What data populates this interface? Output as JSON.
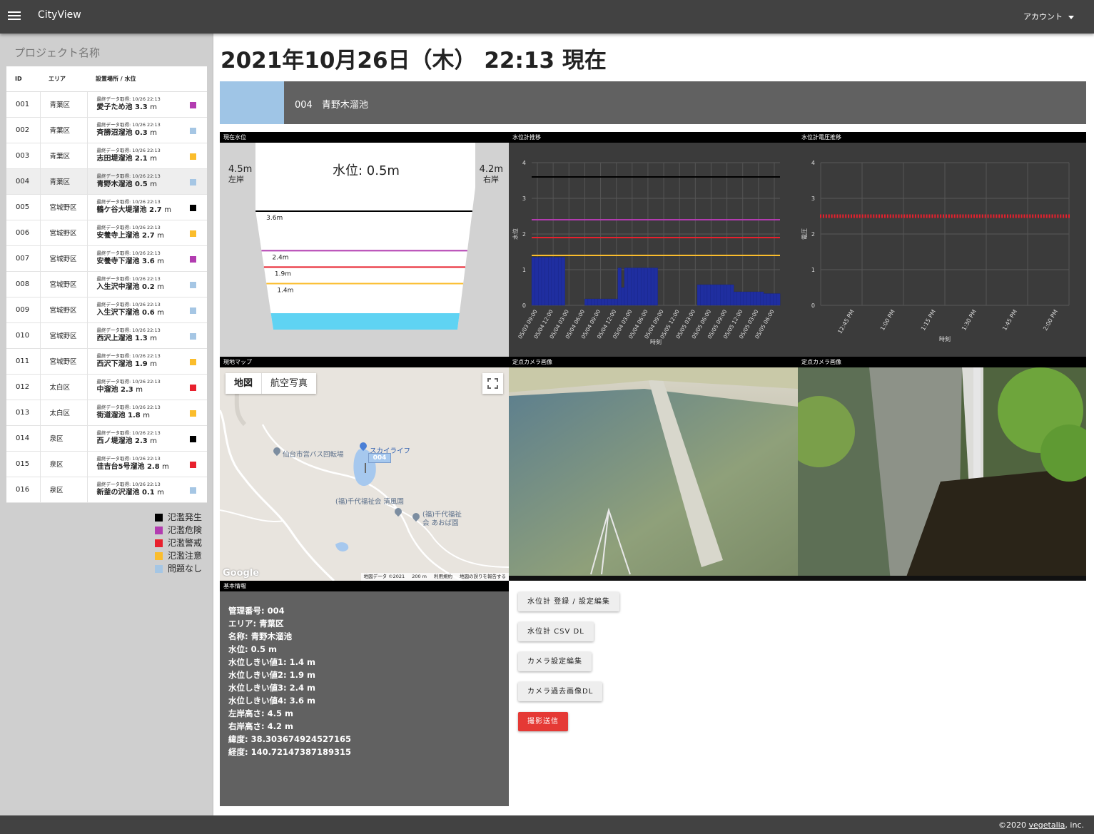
{
  "appbar": {
    "title": "CityView",
    "account_label": "アカウント"
  },
  "sidebar": {
    "project_name": "プロジェクト名称",
    "columns": {
      "id": "ID",
      "area": "エリア",
      "site": "設置場所 / 水位"
    },
    "meta_prefix": "最終データ取得: 10/26 22:13",
    "rows": [
      {
        "id": "001",
        "area": "青葉区",
        "name": "愛子ため池",
        "level": "3.3",
        "unit": "m",
        "status_color": "#b23cb0"
      },
      {
        "id": "002",
        "area": "青葉区",
        "name": "斉勝沼溜池",
        "level": "0.3",
        "unit": "m",
        "status_color": "#a5c6e4"
      },
      {
        "id": "003",
        "area": "青葉区",
        "name": "志田堤溜池",
        "level": "2.1",
        "unit": "m",
        "status_color": "#fbbd2c"
      },
      {
        "id": "004",
        "area": "青葉区",
        "name": "青野木溜池",
        "level": "0.5",
        "unit": "m",
        "status_color": "#a5c6e4"
      },
      {
        "id": "005",
        "area": "宮城野区",
        "name": "鶴ケ谷大堤溜池",
        "level": "2.7",
        "unit": "m",
        "status_color": "#000000"
      },
      {
        "id": "006",
        "area": "宮城野区",
        "name": "安養寺上溜池",
        "level": "2.7",
        "unit": "m",
        "status_color": "#fbbd2c"
      },
      {
        "id": "007",
        "area": "宮城野区",
        "name": "安養寺下溜池",
        "level": "3.6",
        "unit": "m",
        "status_color": "#b23cb0"
      },
      {
        "id": "008",
        "area": "宮城野区",
        "name": "入生沢中溜池",
        "level": "0.2",
        "unit": "m",
        "status_color": "#a5c6e4"
      },
      {
        "id": "009",
        "area": "宮城野区",
        "name": "入生沢下溜池",
        "level": "0.6",
        "unit": "m",
        "status_color": "#a5c6e4"
      },
      {
        "id": "010",
        "area": "宮城野区",
        "name": "西沢上溜池",
        "level": "1.3",
        "unit": "m",
        "status_color": "#a5c6e4"
      },
      {
        "id": "011",
        "area": "宮城野区",
        "name": "西沢下溜池",
        "level": "1.9",
        "unit": "m",
        "status_color": "#fbbd2c"
      },
      {
        "id": "012",
        "area": "太白区",
        "name": "中溜池",
        "level": "2.3",
        "unit": "m",
        "status_color": "#e8202d"
      },
      {
        "id": "013",
        "area": "太白区",
        "name": "街道溜池",
        "level": "1.8",
        "unit": "m",
        "status_color": "#fbbd2c"
      },
      {
        "id": "014",
        "area": "泉区",
        "name": "西ノ堤溜池",
        "level": "2.3",
        "unit": "m",
        "status_color": "#000000"
      },
      {
        "id": "015",
        "area": "泉区",
        "name": "佳吉台5号溜池",
        "level": "2.8",
        "unit": "m",
        "status_color": "#e8202d"
      },
      {
        "id": "016",
        "area": "泉区",
        "name": "新釜の沢溜池",
        "level": "0.1",
        "unit": "m",
        "status_color": "#a5c6e4"
      }
    ],
    "selected_id": "004",
    "legend": [
      {
        "label": "氾濫発生",
        "color": "#000000"
      },
      {
        "label": "氾濫危険",
        "color": "#b23cb0"
      },
      {
        "label": "氾濫警戒",
        "color": "#e8202d"
      },
      {
        "label": "氾濫注意",
        "color": "#fbbd2c"
      },
      {
        "label": "問題なし",
        "color": "#a5c6e4"
      }
    ]
  },
  "main": {
    "title": "2021年10月26日（木） 22:13 現在",
    "banner": {
      "text": "004　青野木溜池",
      "accent_color": "#9fc5e6"
    },
    "panels": {
      "level": "現在水位",
      "chart1": "水位計推移",
      "chart2": "水位計電圧推移",
      "map": "現地マップ",
      "cam1": "定点カメラ画像",
      "cam2": "定点カメラ画像",
      "info": "基本情報"
    },
    "level_diagram": {
      "title": "水位: 0.5m",
      "left_height": "4.5m",
      "left_label": "左岸",
      "right_height": "4.2m",
      "right_label": "右岸",
      "water_level": 0.5,
      "thresholds": [
        {
          "label": "3.6m",
          "value": 3.6,
          "color": "#000000"
        },
        {
          "label": "2.4m",
          "value": 2.4,
          "color": "#b23cb0"
        },
        {
          "label": "1.9m",
          "value": 1.9,
          "color": "#e8202d"
        },
        {
          "label": "1.4m",
          "value": 1.4,
          "color": "#fbbd2c"
        }
      ],
      "water_color": "#5fd3f3"
    },
    "map": {
      "tab_map": "地図",
      "tab_aerial": "航空写真",
      "labels": [
        "仙台市営バス回転場",
        "スカイライフ",
        "(福)千代福祉会 清風園",
        "(福)千代福祉",
        "会 あおば園"
      ],
      "marker": "004",
      "attribution": [
        "地図データ ©2021",
        "200 m",
        "利用規約",
        "地図の誤りを報告する"
      ],
      "logo": "Google"
    },
    "info": [
      "管理番号: 004",
      "エリア: 青葉区",
      "名称: 青野木溜池",
      "水位: 0.5 m",
      "水位しきい値1: 1.4 m",
      "水位しきい値2: 1.9 m",
      "水位しきい値3: 2.4 m",
      "水位しきい値4: 3.6 m",
      "左岸高さ: 4.5 m",
      "右岸高さ: 4.2 m",
      "緯度: 38.303674924527165",
      "経度: 140.72147387189315"
    ],
    "buttons": {
      "register": "水位計 登録 / 設定編集",
      "csv": "水位計 CSV DL",
      "camera_settings": "カメラ設定編集",
      "camera_past": "カメラ過去画像DL",
      "capture": "撮影送信"
    }
  },
  "chart_data": [
    {
      "type": "bar",
      "title": "水位計推移",
      "xlabel": "時刻",
      "ylabel": "水位",
      "ylim": [
        0,
        4
      ],
      "yticks": [
        0,
        1,
        2,
        3,
        4
      ],
      "x_tick_labels": [
        "05/03 09:00",
        "05/04 12:00",
        "05/04 03:00",
        "05/04 06:00",
        "05/04 09:00",
        "05/04 12:00",
        "05/04 03:00",
        "05/04 06:00",
        "05/04 09:00",
        "05/05 12:00",
        "05/05 03:00",
        "05/05 06:00",
        "05/05 09:00",
        "05/05 12:00",
        "05/05 03:00",
        "05/05 06:00"
      ],
      "bar_color": "#1f2ea0",
      "values": [
        1.35,
        1.35,
        1.35,
        1.35,
        1.35,
        1.35,
        1.35,
        1.35,
        1.35,
        1.35,
        0,
        0,
        0,
        0,
        0,
        0,
        0.18,
        0.18,
        0.18,
        0.18,
        0.18,
        0.18,
        0.18,
        0.18,
        0.18,
        0.18,
        1.05,
        0.5,
        1.05,
        1.05,
        1.05,
        1.05,
        1.05,
        1.05,
        1.05,
        1.05,
        1.05,
        1.05,
        0,
        0,
        0,
        0,
        0,
        0,
        0,
        0,
        0,
        0,
        0,
        0,
        0.58,
        0.58,
        0.58,
        0.58,
        0.58,
        0.58,
        0.58,
        0.58,
        0.58,
        0.58,
        0.58,
        0.38,
        0.38,
        0.38,
        0.38,
        0.38,
        0.38,
        0.38,
        0.38,
        0.38,
        0.33,
        0.33,
        0.33,
        0.33,
        0.33
      ],
      "threshold_lines": [
        {
          "value": 3.6,
          "color": "#000000"
        },
        {
          "value": 2.4,
          "color": "#b23cb0"
        },
        {
          "value": 1.9,
          "color": "#e8202d"
        },
        {
          "value": 1.4,
          "color": "#fbbd2c"
        }
      ],
      "grid": true
    },
    {
      "type": "scatter",
      "title": "水位計電圧推移",
      "xlabel": "時刻",
      "ylabel": "電圧",
      "ylim": [
        0,
        4
      ],
      "yticks": [
        0,
        1,
        2,
        3,
        4
      ],
      "x_tick_labels": [
        "12:45 PM",
        "1:00 PM",
        "1:15 PM",
        "1:30 PM",
        "1:45 PM",
        "2:00 PM"
      ],
      "point_color": "#e8202d",
      "value": 2.5,
      "points": 90,
      "grid": true
    }
  ],
  "footer": {
    "copyright": "©2020 ",
    "company": "vegetalia",
    "suffix": ", inc."
  }
}
